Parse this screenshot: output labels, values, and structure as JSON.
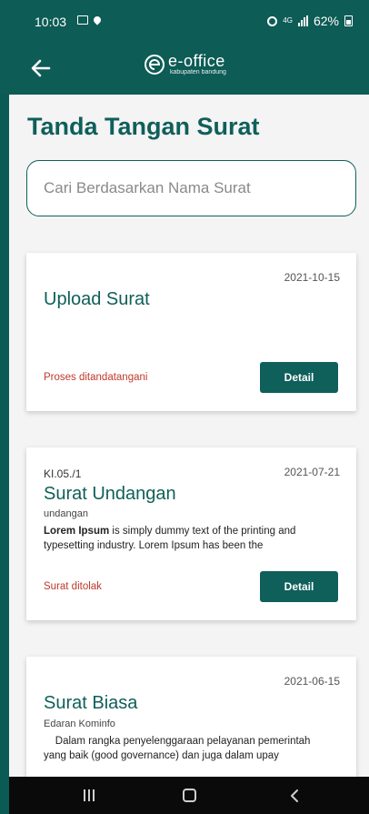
{
  "status_bar": {
    "time": "10:03",
    "network": "4G",
    "battery": "62%",
    "icons": [
      "gallery-icon",
      "location-icon",
      "alarm-icon",
      "signal-icon",
      "battery-icon"
    ]
  },
  "app_bar": {
    "back_icon": "arrow-left-icon",
    "logo_text": "e-office",
    "logo_sub": "kabupaten bandung"
  },
  "page": {
    "title": "Tanda Tangan Surat",
    "search_placeholder": "Cari Berdasarkan Nama Surat"
  },
  "cards": [
    {
      "code": "",
      "date": "2021-10-15",
      "title": "Upload Surat",
      "subtitle": "",
      "body_bold": "",
      "body": "",
      "status": "Proses ditandatangani",
      "button_label": "Detail"
    },
    {
      "code": "KI.05./1",
      "date": "2021-07-21",
      "title": "Surat Undangan",
      "subtitle": "undangan",
      "body_bold": "Lorem Ipsum",
      "body": " is simply dummy text of the printing and typesetting industry. Lorem Ipsum has been the",
      "status": "Surat ditolak",
      "button_label": "Detail"
    },
    {
      "code": "",
      "date": "2021-06-15",
      "title": "Surat Biasa",
      "subtitle": "Edaran Kominfo",
      "body_bold": "",
      "body": "    Dalam rangka penyelenggaraan pelayanan pemerintah yang baik (good governance) dan juga dalam upay",
      "status": "",
      "button_label": ""
    }
  ],
  "colors": {
    "primary": "#0f5f5a",
    "status_red": "#c0392b",
    "background": "#f4f4f4"
  },
  "nav_bar": {
    "icons": [
      "recent-apps-icon",
      "home-icon",
      "back-icon"
    ]
  }
}
